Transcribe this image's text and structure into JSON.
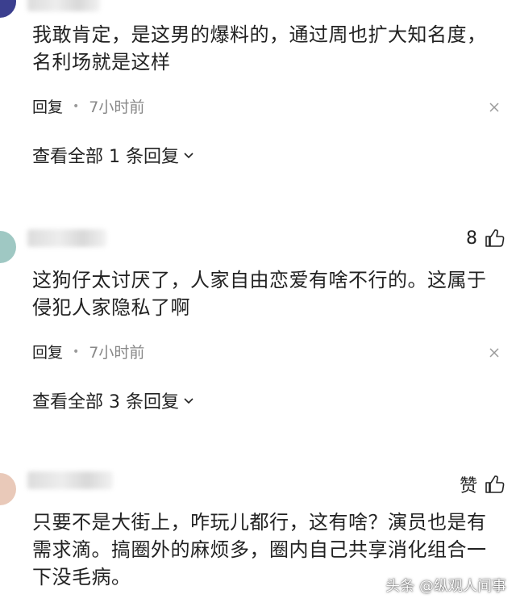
{
  "comments": [
    {
      "username_partial": "",
      "text": "我敢肯定，是这男的爆料的，通过周也扩大知名度，名利场就是这样",
      "reply_label": "回复",
      "time": "7小时前",
      "view_all": "查看全部 1 条回复",
      "likes": null
    },
    {
      "username_partial": "",
      "text": "这狗仔太讨厌了，人家自由恋爱有啥不行的。这属于侵犯人家隐私了啊",
      "reply_label": "回复",
      "time": "7小时前",
      "view_all": "查看全部 3 条回复",
      "likes": "8"
    },
    {
      "username_partial": "",
      "text": "只要不是大街上，咋玩儿都行，这有啥？演员也是有需求滴。搞圈外的麻烦多，圈内自己共享消化组合一下没毛病。",
      "likes": "赞"
    }
  ],
  "watermark": "头条 @纵观人间事",
  "colors": {
    "text": "#222222",
    "muted": "#888888",
    "avatar1": "#3b3f8f",
    "avatar2": "#9fc8c3",
    "avatar3": "#e9c9b9"
  }
}
